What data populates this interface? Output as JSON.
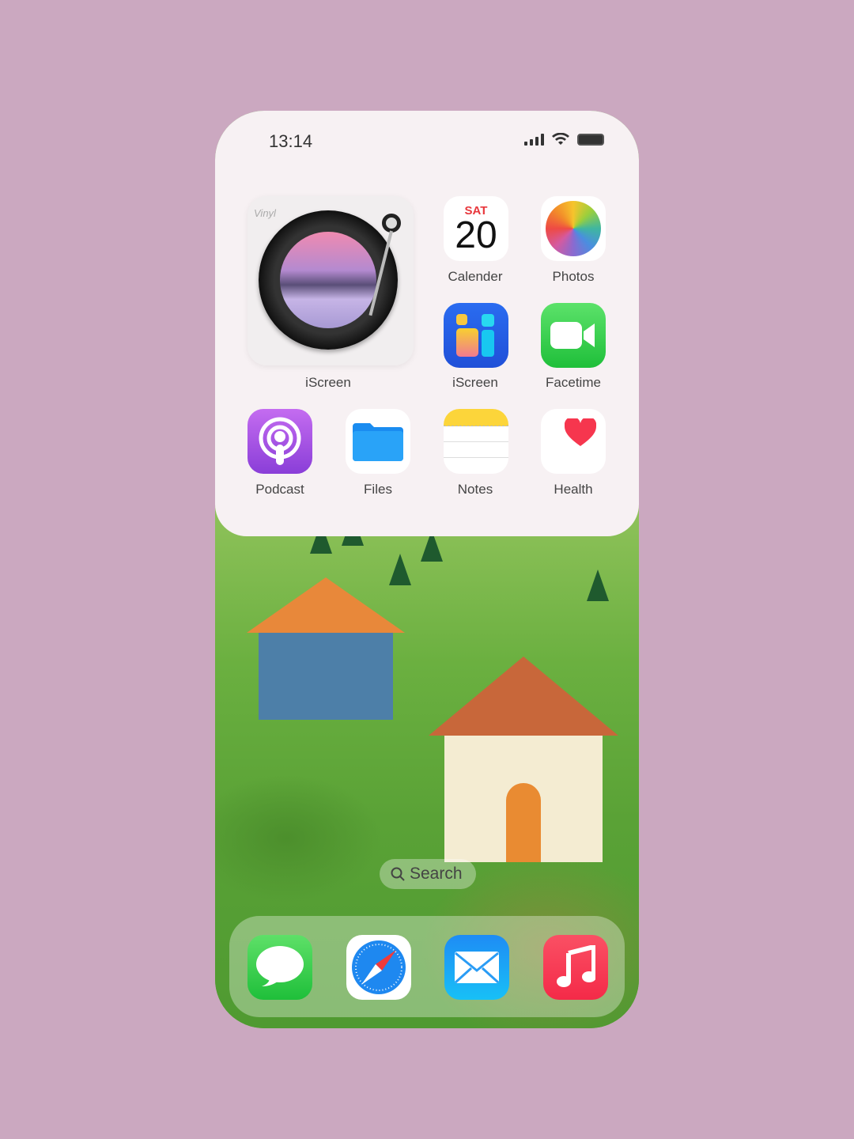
{
  "status": {
    "time": "13:14"
  },
  "widget": {
    "brand": "Vinyl",
    "label": "iScreen"
  },
  "apps": [
    {
      "label": "Calender",
      "day": "SAT",
      "date": "20"
    },
    {
      "label": "Photos"
    },
    {
      "label": "iScreen"
    },
    {
      "label": "Facetime"
    },
    {
      "label": "Podcast"
    },
    {
      "label": "Files"
    },
    {
      "label": "Notes"
    },
    {
      "label": "Health"
    }
  ],
  "search": {
    "label": "Search"
  },
  "dock": [
    {
      "icon": "messages-icon"
    },
    {
      "icon": "safari-icon"
    },
    {
      "icon": "mail-icon"
    },
    {
      "icon": "music-icon"
    }
  ],
  "colors": {
    "background": "#cba8c0",
    "panel": "#f7f1f3"
  }
}
